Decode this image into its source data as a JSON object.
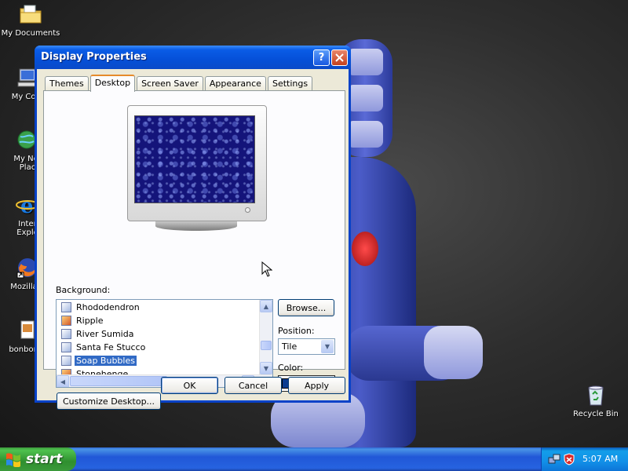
{
  "desktop": {
    "icons": [
      {
        "label": "My Documents",
        "icon": "folder-icon"
      },
      {
        "label": "My Com",
        "icon": "computer-icon"
      },
      {
        "label": "My Net",
        "label2": "Plac",
        "icon": "network-icon"
      },
      {
        "label": "Inter",
        "label2": "Explo",
        "icon": "ie-icon"
      },
      {
        "label": "Mozilla F",
        "icon": "firefox-icon"
      },
      {
        "label": "bonbon-a",
        "icon": "image-file-icon"
      },
      {
        "label": "Recycle Bin",
        "icon": "recycle-bin-icon"
      }
    ]
  },
  "window": {
    "title": "Display Properties",
    "tabs": [
      "Themes",
      "Desktop",
      "Screen Saver",
      "Appearance",
      "Settings"
    ],
    "active_tab": "Desktop",
    "background_label": "Background:",
    "backgrounds": [
      {
        "name": "Rhododendron",
        "icon": "bitmap-icon"
      },
      {
        "name": "Ripple",
        "icon": "picture-icon"
      },
      {
        "name": "River Sumida",
        "icon": "bitmap-icon"
      },
      {
        "name": "Santa Fe Stucco",
        "icon": "bitmap-icon"
      },
      {
        "name": "Soap Bubbles",
        "icon": "bitmap-icon",
        "selected": true
      },
      {
        "name": "Stonehenge",
        "icon": "picture-icon"
      }
    ],
    "browse_label": "Browse...",
    "position_label": "Position:",
    "position_value": "Tile",
    "color_label": "Color:",
    "color_value": "#0a3d91",
    "customize_label": "Customize Desktop...",
    "ok_label": "OK",
    "cancel_label": "Cancel",
    "apply_label": "Apply"
  },
  "taskbar": {
    "start_label": "start",
    "clock": "5:07 AM"
  },
  "colors": {
    "title_blue": "#0550d8",
    "selection": "#316ac5",
    "start_green": "#3a9a3a",
    "taskbar_blue": "#2157d7"
  }
}
